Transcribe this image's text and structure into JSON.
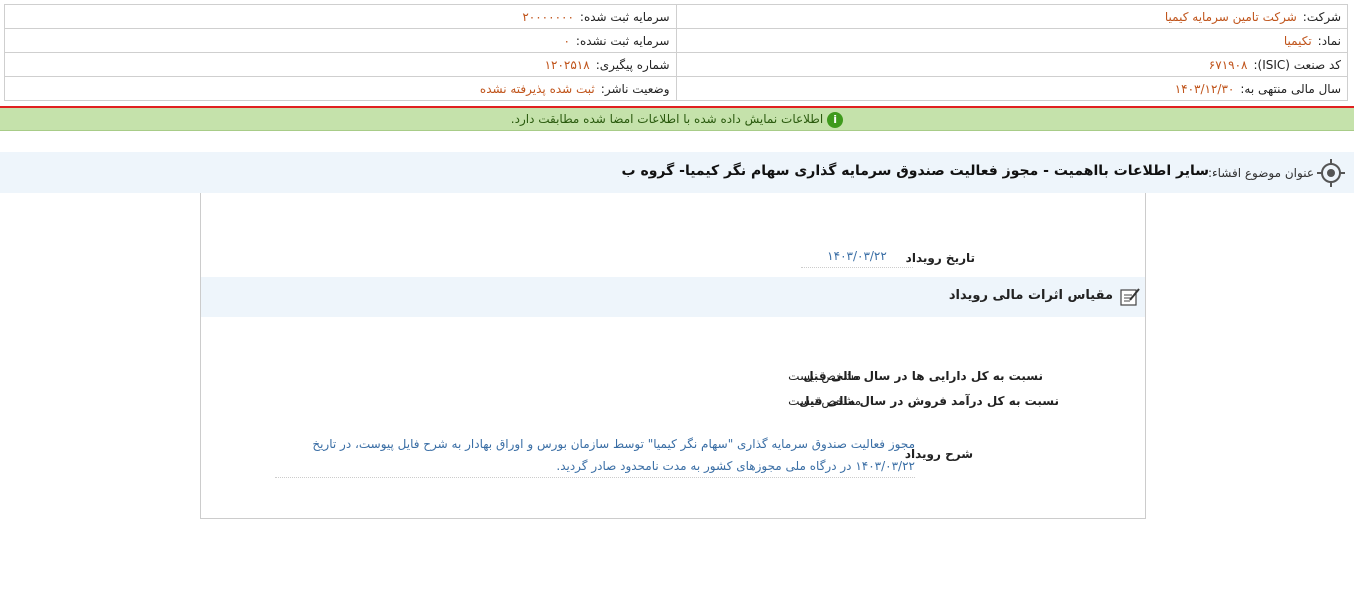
{
  "header": {
    "company_label": "شرکت:",
    "company_value": "شرکت تامین سرمایه کیمیا",
    "symbol_label": "نماد:",
    "symbol_value": "تکیمیا",
    "isic_label": "کد صنعت (ISIC):",
    "isic_value": "۶۷۱۹۰۸",
    "fiscal_label": "سال مالی منتهی به:",
    "fiscal_value": "۱۴۰۳/۱۲/۳۰",
    "reg_capital_label": "سرمایه ثبت شده:",
    "reg_capital_value": "۲۰۰۰۰۰۰۰",
    "unreg_capital_label": "سرمایه ثبت نشده:",
    "unreg_capital_value": "۰",
    "tracking_label": "شماره پیگیری:",
    "tracking_value": "۱۲۰۲۵۱۸",
    "publisher_status_label": "وضعیت ناشر:",
    "publisher_status_value": "ثبت شده پذیرفته نشده"
  },
  "notice": {
    "text": "اطلاعات نمایش داده شده با اطلاعات امضا شده مطابقت دارد.",
    "icon": "info-icon",
    "color": "#c5e2ab"
  },
  "subject": {
    "label": "عنوان موضوع افشاء:",
    "text": "سایر اطلاعات بااهمیت - مجوز فعالیت صندوق سرمایه گذاری سهام نگر کیمیا- گروه ب"
  },
  "event": {
    "date_label": "تاریخ رویداد",
    "date_value": "۱۴۰۳/۰۳/۲۲",
    "section_title": "مقیاس اثرات مالی رویداد",
    "ratios": [
      {
        "label": "نسبت به کل دارایی ها در سال مالی قبل",
        "value": "مشخص نیست"
      },
      {
        "label": "نسبت به کل درآمد فروش در سال مالی قبل",
        "value": "مشخص نیست"
      }
    ],
    "desc_label": "شرح رویداد",
    "desc_text": "مجوز فعالیت صندوق سرمایه گذاری \"سهام نگر کیمیا\" توسط سازمان بورس و اوراق بهادار به شرح فایل پیوست، در تاریخ ۱۴۰۳/۰۳/۲۲ در درگاه ملی مجوزهای کشور به مدت نامحدود صادر گردید."
  },
  "colors": {
    "accent_orange": "#c0541b",
    "link_blue": "#3a6ea5",
    "red_line": "#e02020",
    "bar_bg": "#eef5fb"
  }
}
